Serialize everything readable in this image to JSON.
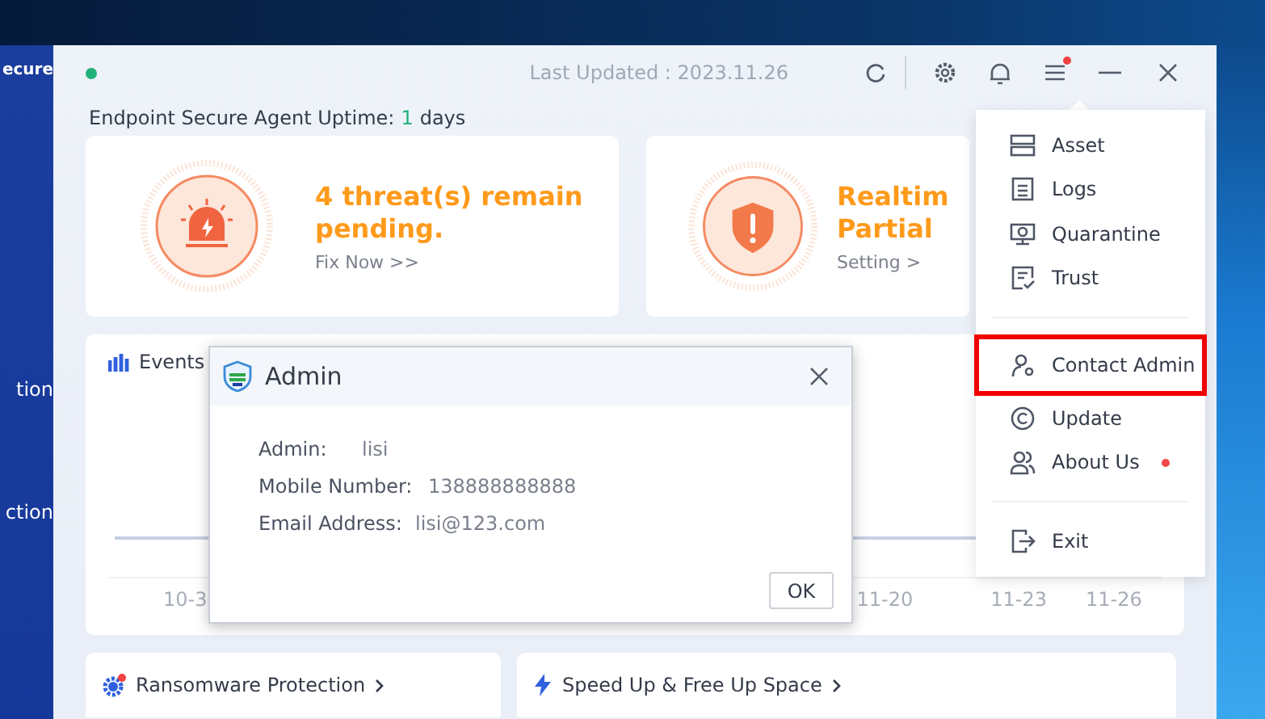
{
  "background_window": {
    "title": "ecure",
    "sidebar_items": [
      {
        "label": "tion"
      },
      {
        "label": "ction"
      }
    ]
  },
  "window": {
    "online": true,
    "last_updated": "Last Updated : 2023.11.26",
    "menu_badge": true
  },
  "uptime": {
    "label": "Endpoint Secure Agent Uptime:",
    "value": "1",
    "unit": "days"
  },
  "status_cards": [
    {
      "kind": "threat",
      "title": "4 threat(s) remain pending.",
      "link": "Fix Now >>"
    },
    {
      "kind": "shield",
      "title": "Realtim Partial",
      "link": "Setting >"
    }
  ],
  "events_card": {
    "title": "Events",
    "x_labels": [
      "10-3",
      "11-20",
      "11-23",
      "11-26"
    ]
  },
  "bottom_cards": [
    {
      "kind": "ransomware",
      "title": "Ransomware Protection",
      "badge": true
    },
    {
      "kind": "speed",
      "title": "Speed Up & Free Up Space",
      "badge": false
    }
  ],
  "menu": {
    "groups": [
      [
        {
          "kind": "asset",
          "label": "Asset",
          "highlighted": false,
          "badge": false
        },
        {
          "kind": "logs",
          "label": "Logs",
          "highlighted": false,
          "badge": false
        },
        {
          "kind": "quarantine",
          "label": "Quarantine",
          "highlighted": false,
          "badge": false
        },
        {
          "kind": "trust",
          "label": "Trust",
          "highlighted": false,
          "badge": false
        }
      ],
      [
        {
          "kind": "contact",
          "label": "Contact Admin",
          "highlighted": true,
          "badge": false
        },
        {
          "kind": "update",
          "label": "Update",
          "highlighted": false,
          "badge": false
        },
        {
          "kind": "about",
          "label": "About Us",
          "highlighted": false,
          "badge": true
        }
      ],
      [
        {
          "kind": "exit",
          "label": "Exit",
          "highlighted": false,
          "badge": false
        }
      ]
    ]
  },
  "dialog": {
    "title": "Admin",
    "fields": [
      {
        "label": "Admin:",
        "value": "lisi"
      },
      {
        "label": "Mobile Number:",
        "value": "138888888888"
      },
      {
        "label": "Email Address:",
        "value": "lisi@123.com"
      }
    ],
    "button": "OK"
  }
}
